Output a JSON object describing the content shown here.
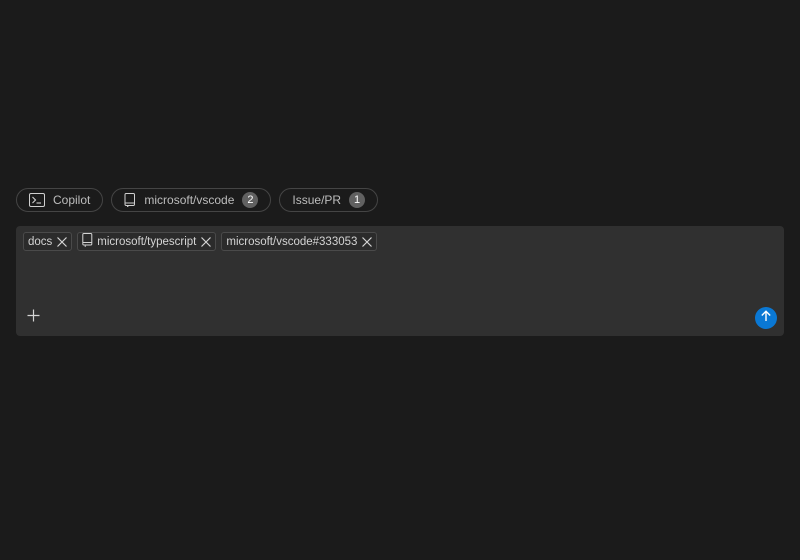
{
  "pills": [
    {
      "label": "Copilot",
      "icon": "terminal-icon"
    },
    {
      "label": "microsoft/vscode",
      "icon": "repo-icon",
      "count": "2"
    },
    {
      "label": "Issue/PR",
      "count": "1"
    }
  ],
  "chips": [
    {
      "label": "docs"
    },
    {
      "label": "microsoft/typescript",
      "icon": "repo-icon"
    },
    {
      "label": "microsoft/vscode#333053"
    }
  ],
  "colors": {
    "background": "#1b1b1b",
    "composer": "#303030",
    "accent": "#0a78d4"
  },
  "actions": {
    "add_icon": "plus-icon",
    "send_icon": "arrow-up-icon"
  }
}
